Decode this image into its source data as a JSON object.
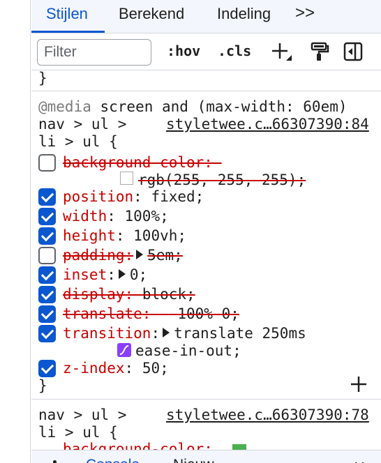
{
  "tabs": [
    {
      "label": "Stijlen"
    },
    {
      "label": "Berekend"
    },
    {
      "label": "Indeling"
    },
    {
      "label": ">>"
    }
  ],
  "toolbar": {
    "filter_placeholder": "Filter",
    "hov_label": ":hov",
    "cls_label": ".cls",
    "icons": [
      "add-rule-icon",
      "paint-roller-icon",
      "toggle-sidebar-icon"
    ]
  },
  "prev_rule_close": "}",
  "rule1": {
    "media_at": "@media",
    "media_query": " screen and (max-width: 60em)",
    "selector_line1": "nav > ul >",
    "selector_line2": "li > ul {",
    "source": "styletwee.c…66307390:84",
    "declarations": [
      {
        "name": "background-color",
        "value": "",
        "checked": false,
        "overridden": true
      },
      {
        "name": "",
        "value": "rgb(255, 255, 255);",
        "checked": false,
        "overridden": true
      },
      {
        "name": "position",
        "value": "fixed;",
        "checked": true,
        "overridden": false
      },
      {
        "name": "width",
        "value": "100%;",
        "checked": true,
        "overridden": false
      },
      {
        "name": "height",
        "value": "100vh;",
        "checked": true,
        "overridden": false
      },
      {
        "name": "padding",
        "value": "5em;",
        "checked": false,
        "overridden": true
      },
      {
        "name": "inset",
        "value": "0;",
        "checked": true,
        "overridden": false
      },
      {
        "name": "display",
        "value": "block;",
        "checked": true,
        "overridden": true
      },
      {
        "name": "translate",
        "value": "-100% 0;",
        "checked": true,
        "overridden": true
      },
      {
        "name": "transition",
        "value": "translate 250ms",
        "checked": true,
        "overridden": false
      },
      {
        "name": "",
        "value": "ease-in-out;",
        "checked": true,
        "overridden": false
      },
      {
        "name": "z-index",
        "value": "50;",
        "checked": true,
        "overridden": false
      }
    ],
    "close": "}"
  },
  "rule2": {
    "selector_line1": "nav > ul >",
    "selector_line2": "li > ul {",
    "source": "styletwee.c…66307390:78",
    "partial_line": "background-color: "
  },
  "bottom": {
    "tab1": "Console",
    "tab2": "Nieuw",
    "close": "✕"
  },
  "colors": {
    "accent": "#0b57d0",
    "property_name": "#c80000",
    "ease_icon": "#8a3ffc"
  }
}
